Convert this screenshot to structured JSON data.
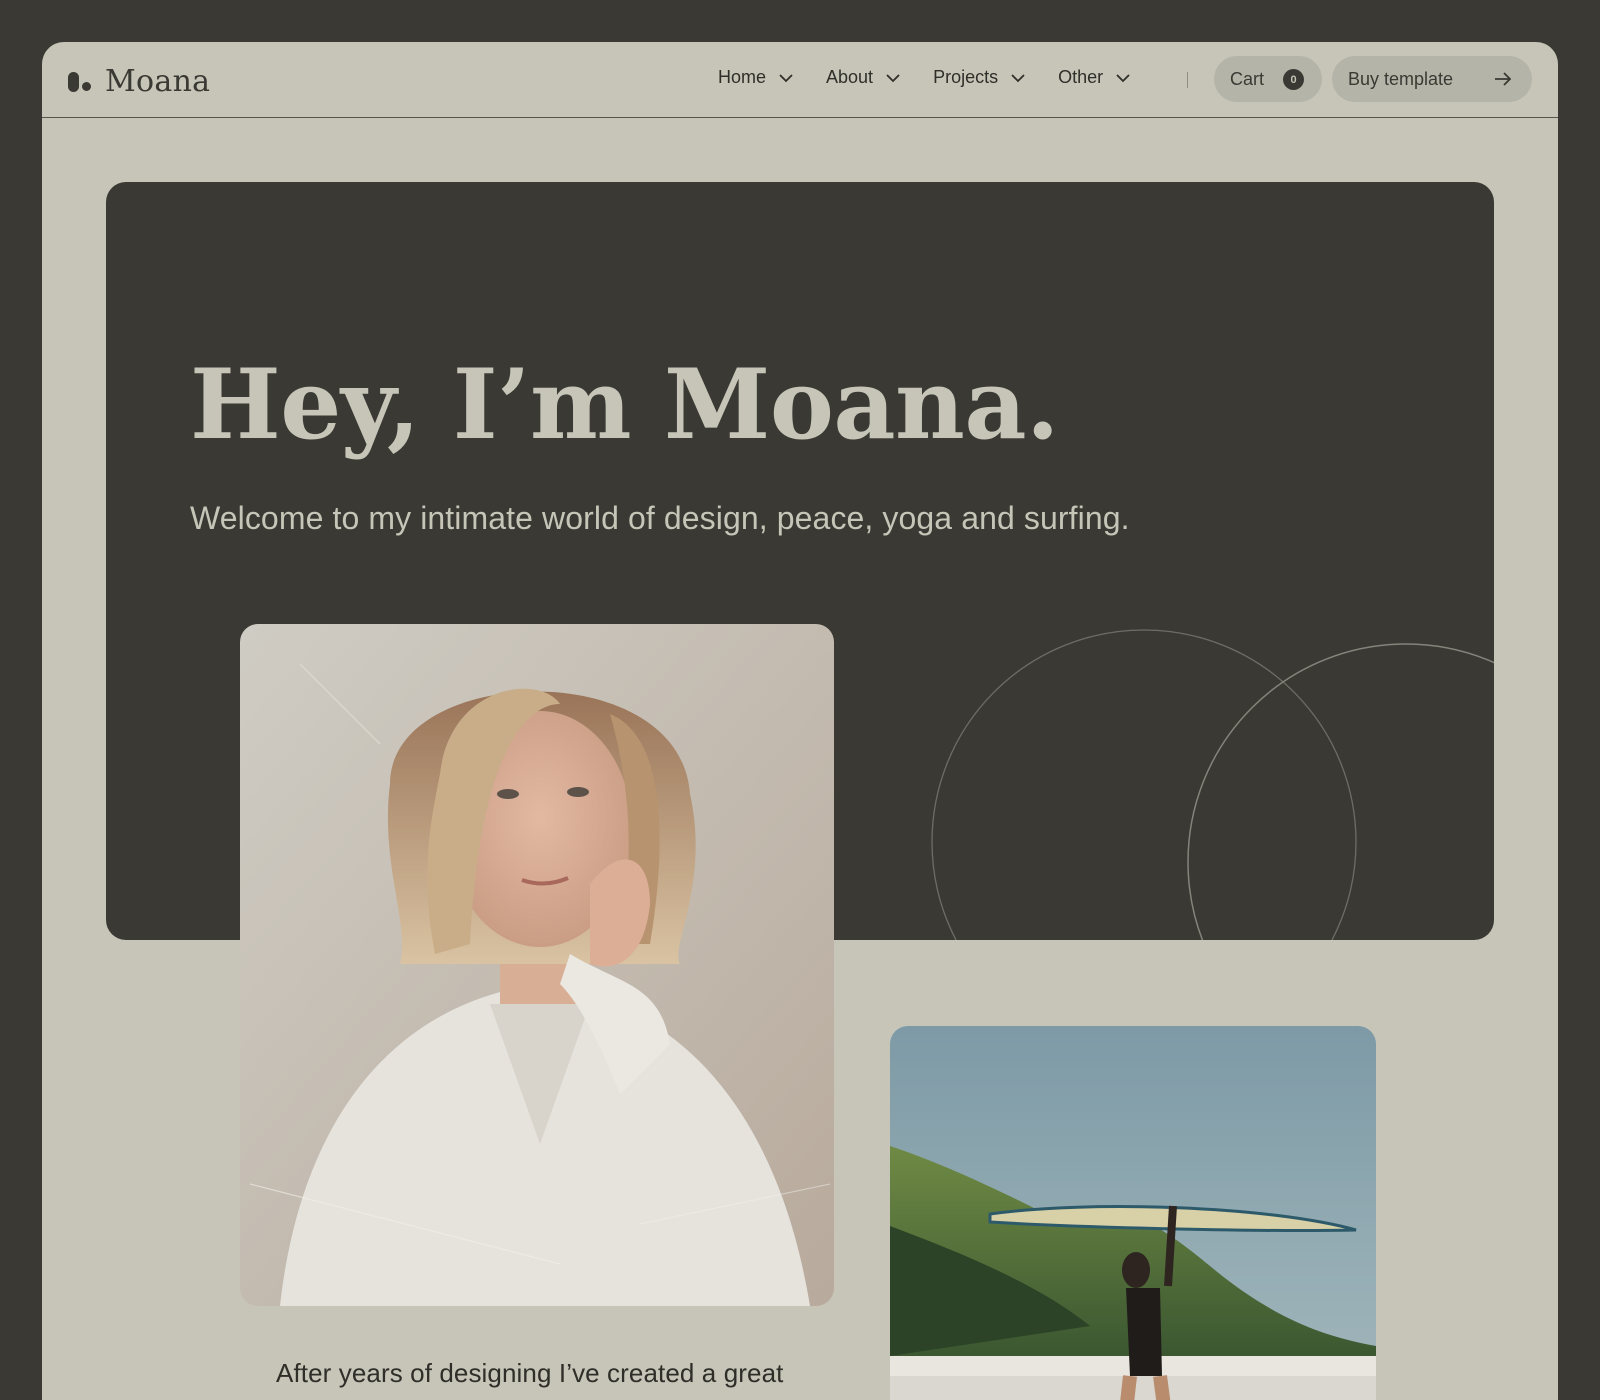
{
  "brand": {
    "name": "Moana"
  },
  "nav": {
    "items": [
      {
        "label": "Home"
      },
      {
        "label": "About"
      },
      {
        "label": "Projects"
      },
      {
        "label": "Other"
      }
    ],
    "cart": {
      "label": "Cart",
      "count": "0"
    },
    "buy": {
      "label": "Buy template"
    }
  },
  "hero": {
    "title": "Hey, I’m Moana.",
    "subtitle": "Welcome to my intimate world of design, peace, yoga and surfing."
  },
  "about": {
    "text": "After years of designing I’ve created a great"
  },
  "colors": {
    "background": "#3a3933",
    "surface": "#c6c5b8",
    "pill": "#b5b4a8",
    "text_dark": "#2f2e29"
  },
  "icons": {
    "chevron": "chevron-down-icon",
    "arrow": "arrow-right-icon"
  }
}
